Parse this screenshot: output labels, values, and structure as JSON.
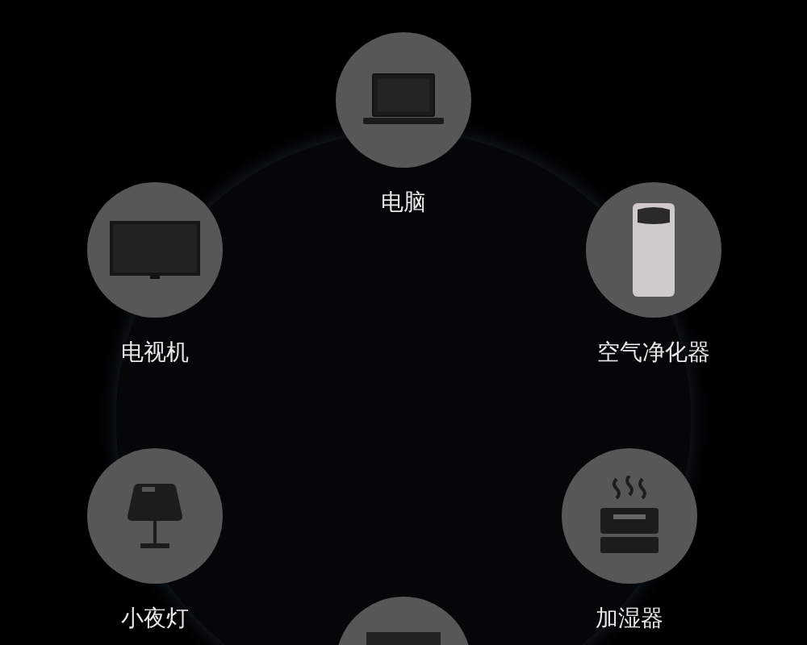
{
  "devices": [
    {
      "kind": "laptop",
      "label": "电脑"
    },
    {
      "kind": "tv",
      "label": "电视机"
    },
    {
      "kind": "purifier",
      "label": "空气净化器"
    },
    {
      "kind": "lamp",
      "label": "小夜灯"
    },
    {
      "kind": "humidifier",
      "label": "加湿器"
    },
    {
      "kind": "box"
    }
  ]
}
